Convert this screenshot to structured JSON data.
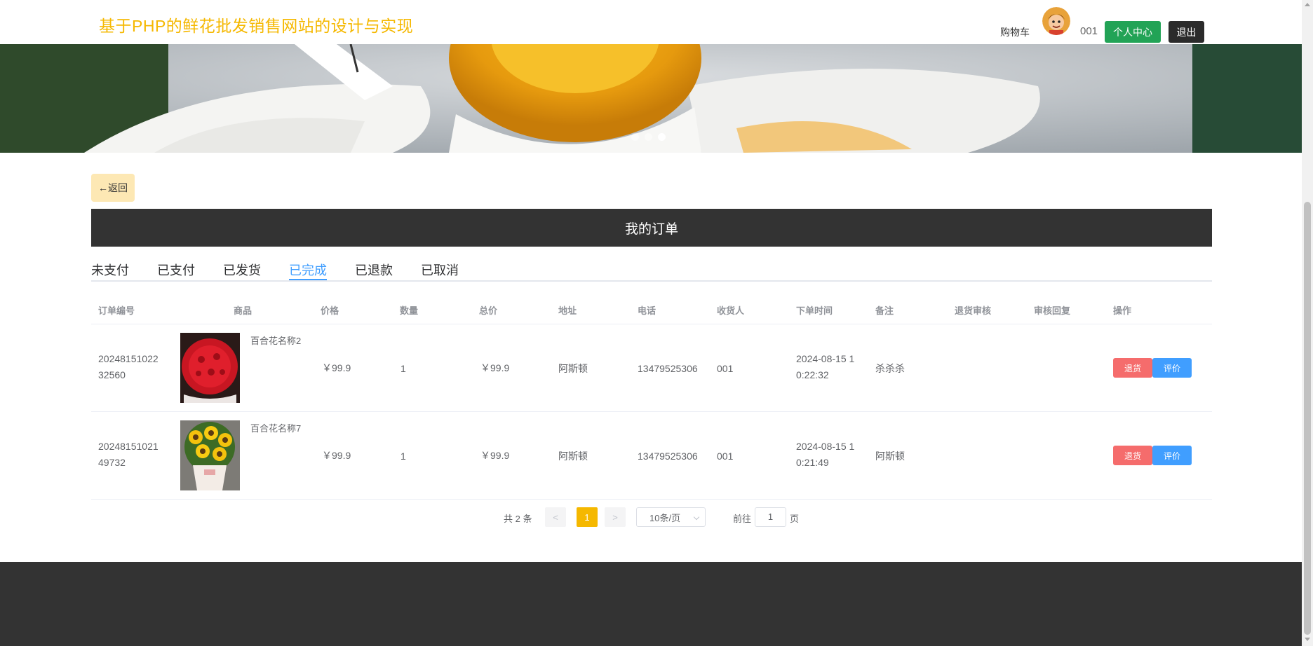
{
  "header": {
    "site_title": "基于PHP的鲜花批发销售网站的设计与实现",
    "cart_label": "购物车",
    "username": "001",
    "center_label": "个人中心",
    "logout_label": "退出"
  },
  "banner": {
    "dots": 3,
    "active_dot": 3
  },
  "back_label": "←返回",
  "section_title": "我的订单",
  "tabs": [
    "未支付",
    "已支付",
    "已发货",
    "已完成",
    "已退款",
    "已取消"
  ],
  "active_tab": "已完成",
  "table": {
    "headers": [
      "订单编号",
      "商品",
      "价格",
      "数量",
      "总价",
      "地址",
      "电话",
      "收货人",
      "下单时间",
      "备注",
      "退货审核",
      "审核回复",
      "操作"
    ],
    "rows": [
      {
        "order_no_line1": "20248151022",
        "order_no_line2": "32560",
        "product_name": "百合花名称2",
        "product_image": "red-roses-bouquet",
        "price": "￥99.9",
        "quantity": "1",
        "total": "￥99.9",
        "address": "阿斯顿",
        "phone": "13479525306",
        "receiver": "001",
        "time_line1": "2024-08-15 1",
        "time_line2": "0:22:32",
        "remark": "杀杀杀",
        "return_audit": "",
        "audit_reply": "",
        "return_label": "退货",
        "review_label": "评价"
      },
      {
        "order_no_line1": "20248151021",
        "order_no_line2": "49732",
        "product_name": "百合花名称7",
        "product_image": "sunflower-bouquet",
        "price": "￥99.9",
        "quantity": "1",
        "total": "￥99.9",
        "address": "阿斯顿",
        "phone": "13479525306",
        "receiver": "001",
        "time_line1": "2024-08-15 1",
        "time_line2": "0:21:49",
        "remark": "阿斯顿",
        "return_audit": "",
        "audit_reply": "",
        "return_label": "退货",
        "review_label": "评价"
      }
    ]
  },
  "pagination": {
    "total_text": "共 2 条",
    "prev": "<",
    "current_page": "1",
    "next": ">",
    "page_size": "10条/页",
    "goto_label": "前往",
    "goto_value": "1",
    "page_suffix": "页"
  },
  "colors": {
    "title": "#f5b800",
    "center_btn": "#22a356",
    "logout_btn": "#2b2b2b",
    "section_bg": "#333333",
    "active_tab": "#409eff",
    "return_btn": "#f56c6c",
    "review_btn": "#409eff",
    "current_page": "#f5b800",
    "back_btn": "#fde8b4"
  }
}
